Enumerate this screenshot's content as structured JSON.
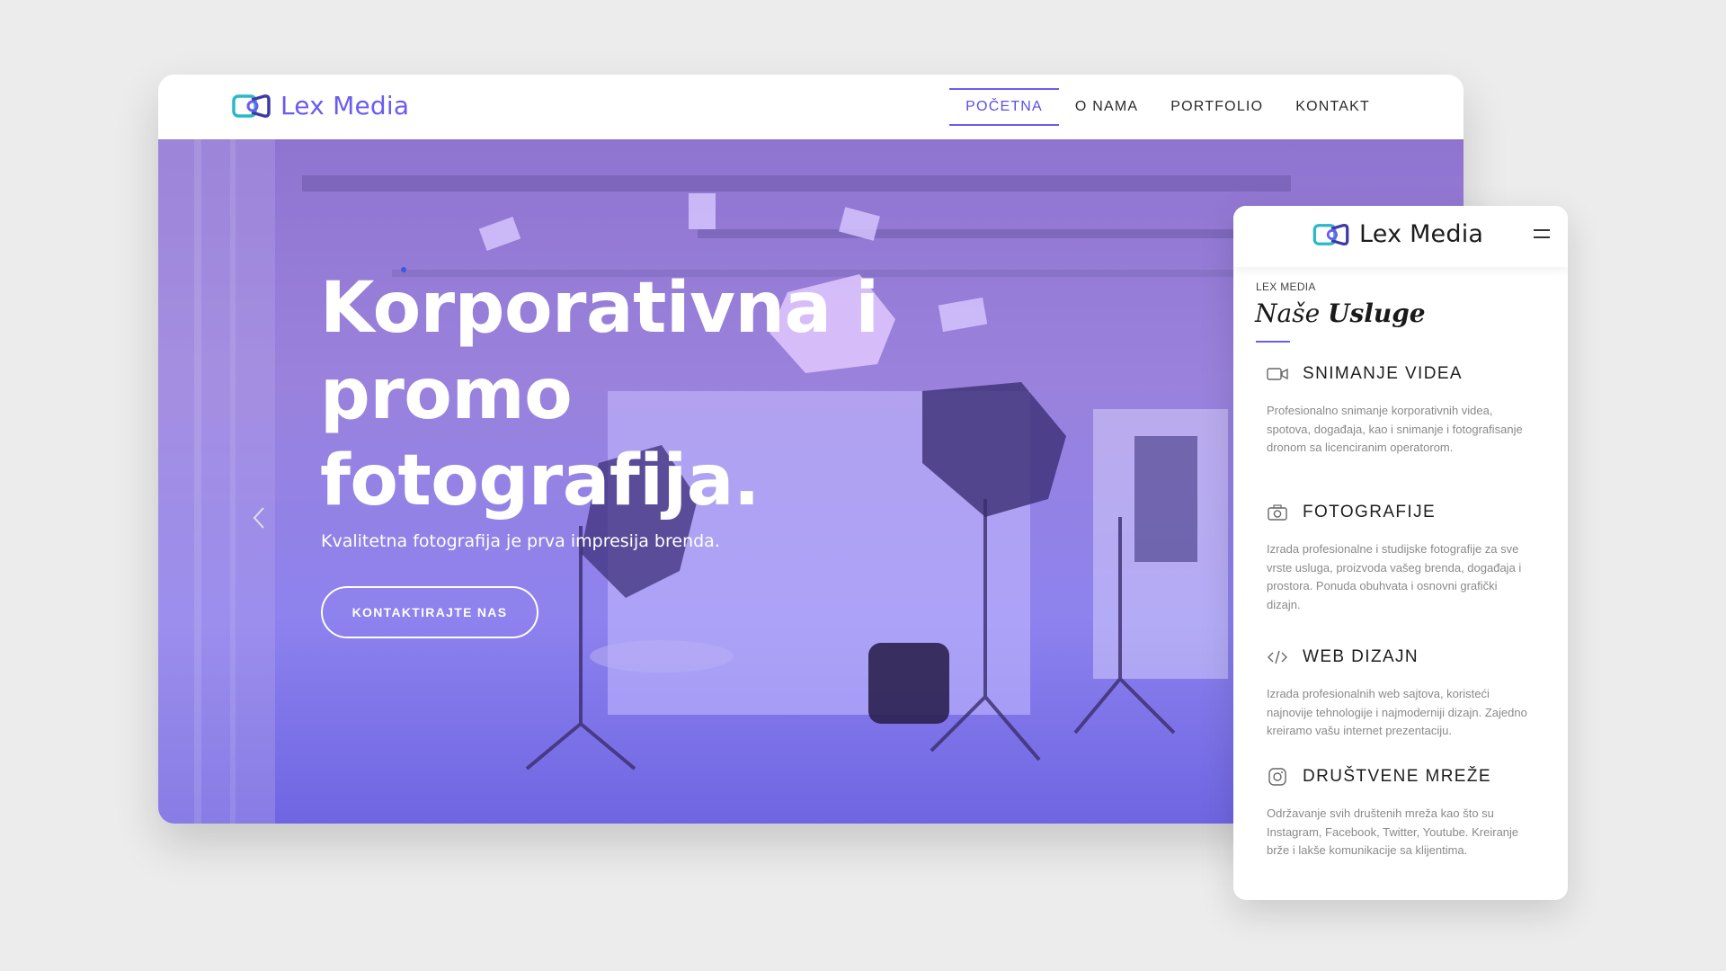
{
  "desktop": {
    "logo": {
      "text": "Lex Media",
      "icon": "lex-media-logo-icon"
    },
    "menu": [
      {
        "label": "POČETNA",
        "active": true
      },
      {
        "label": "O NAMA",
        "active": false
      },
      {
        "label": "PORTFOLIO",
        "active": false
      },
      {
        "label": "KONTAKT",
        "active": false
      }
    ],
    "hero": {
      "title_lines": [
        "Korporativna i",
        "promo",
        "fotografija."
      ],
      "subtitle": "Kvalitetna fotografija je prva impresija brenda.",
      "button": "KONTAKTIRAJTE NAS",
      "prev_icon": "chevron-left-icon",
      "overlay_colors": [
        "#8f74d0",
        "#6f65e2"
      ]
    }
  },
  "mobile": {
    "logo": {
      "text": "Lex Media",
      "icon": "lex-media-logo-icon"
    },
    "menu_icon": "hamburger-icon",
    "kicker": "LEX MEDIA",
    "heading_light": "Naše",
    "heading_bold": "Usluge",
    "services": [
      {
        "icon": "video-camera-icon",
        "title": "SNIMANJE VIDEA",
        "text": "Profesionalno snimanje korporativnih videa, spotova, događaja, kao i snimanje i fotografisanje dronom sa licenciranim operatorom."
      },
      {
        "icon": "camera-icon",
        "title": "FOTOGRAFIJE",
        "text": "Izrada profesionalne i studijske fotografije za sve vrste usluga, proizvoda vašeg brenda, događaja i prostora. Ponuda obuhvata i osnovni grafički dizajn."
      },
      {
        "icon": "code-icon",
        "title": "WEB DIZAJN",
        "text": "Izrada profesionalnih web sajtova, koristeći najnovije tehnologije i najmoderniji dizajn. Zajedno kreiramo vašu internet prezentaciju."
      },
      {
        "icon": "instagram-icon",
        "title": "DRUŠTVENE MREŽE",
        "text": "Održavanje svih društenih mreža kao što su Instagram, Facebook, Twitter, Youtube. Kreiranje brže i lakše komunikacije sa klijentima."
      }
    ]
  },
  "colors": {
    "accent": "#6a5cf0",
    "logo_teal": "#29b8c8",
    "background": "#ececec"
  }
}
